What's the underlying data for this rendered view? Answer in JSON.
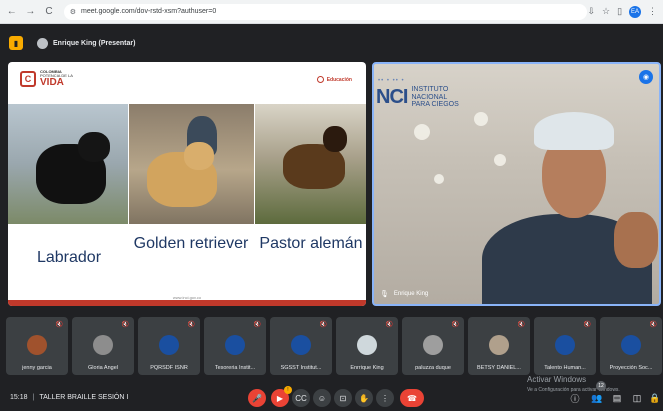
{
  "browser": {
    "url": "meet.google.com/dov-rstd-xsm?authuser=0",
    "nav": [
      "←",
      "→",
      "C"
    ],
    "profile_initial": "EA"
  },
  "meet_top": {
    "presenter_label": "Enrique King (Presentar)"
  },
  "slide": {
    "logo_line1": "COLOMBIA",
    "logo_line2": "POTENCIA DE LA",
    "logo_line3": "VIDA",
    "edu_label": "Educación",
    "captions": [
      "Labrador",
      "Golden retriever",
      "Pastor alemán"
    ],
    "footer_url": "www.inci.gov.co"
  },
  "speaker": {
    "org_short": "NCI",
    "org_line1": "INSTITUTO",
    "org_line2": "NACIONAL",
    "org_line3": "PARA CIEGOS",
    "name": "Enrique King"
  },
  "participants": [
    {
      "name": "jenny garcia",
      "color": "#a0522d"
    },
    {
      "name": "Gloria Angel",
      "color": "#8d8d8d"
    },
    {
      "name": "PQRSDF ISNR",
      "color": "#1a4fa0"
    },
    {
      "name": "Tesoreria Instit...",
      "color": "#1a4fa0"
    },
    {
      "name": "SGSST Institut...",
      "color": "#1a4fa0"
    },
    {
      "name": "Enrrique King",
      "color": "#cfd8dc"
    },
    {
      "name": "paluzza duque",
      "color": "#9e9e9e"
    },
    {
      "name": "BETSY DANIEL...",
      "color": "#b0a08c"
    },
    {
      "name": "Talento Human...",
      "color": "#1a4fa0"
    },
    {
      "name": "Proyección Soc...",
      "color": "#1a4fa0"
    }
  ],
  "bottom": {
    "time": "15:18",
    "separator": "|",
    "meeting_name": "TALLER BRAILLE SESIÓN I",
    "activate_windows": "Activar Windows",
    "activate_sub": "Ve a Configuración para activar Windows.",
    "participant_count": "12"
  }
}
